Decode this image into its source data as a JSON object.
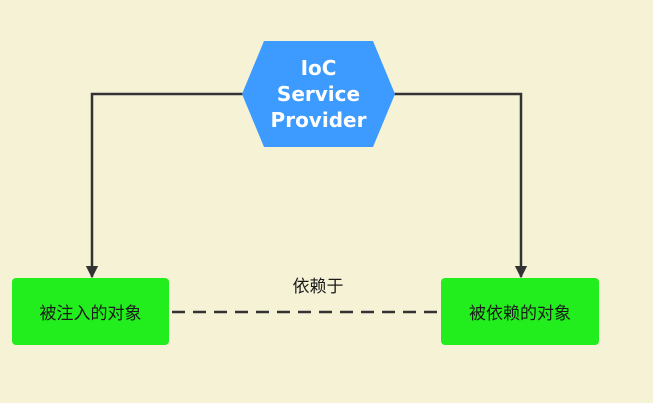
{
  "provider": {
    "lines": [
      "IoC",
      "Service",
      "Provider"
    ],
    "fill": "#3d9bff"
  },
  "nodes": {
    "injected": "被注入的对象",
    "depended": "被依赖的对象",
    "fill": "#22ee1e"
  },
  "relation": {
    "label": "依赖于"
  },
  "colors": {
    "background": "#f5f2d6",
    "connector": "#333333"
  }
}
